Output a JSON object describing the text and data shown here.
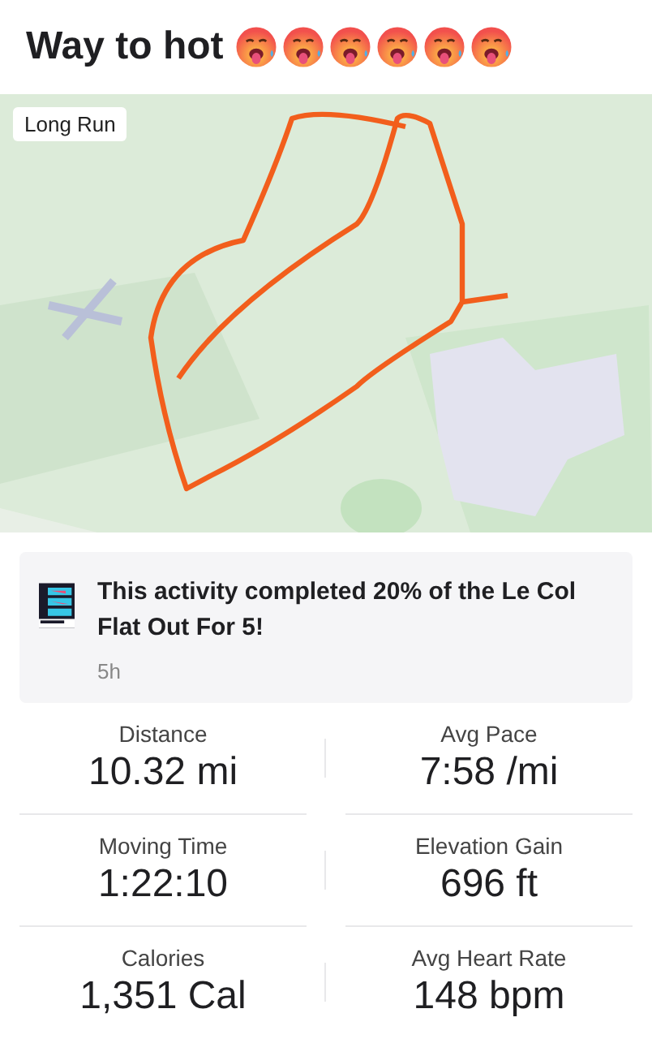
{
  "title": "Way to hot",
  "title_emoji": [
    {
      "kind": "hot-face"
    },
    {
      "kind": "hot-face"
    },
    {
      "kind": "hot-face"
    },
    {
      "kind": "hot-face"
    },
    {
      "kind": "hot-face"
    },
    {
      "kind": "hot-face"
    }
  ],
  "map": {
    "kind": "picture",
    "label": "Long Run"
  },
  "challenge": {
    "text": "This activity completed 20% of the Le Col Flat Out For 5!",
    "time": "5h"
  },
  "stats": [
    {
      "label": "Distance",
      "value": "10.32 mi"
    },
    {
      "label": "Avg Pace",
      "value": "7:58 /mi"
    },
    {
      "label": "Moving Time",
      "value": "1:22:10"
    },
    {
      "label": "Elevation Gain",
      "value": "696 ft"
    },
    {
      "label": "Calories",
      "value": "1,351 Cal"
    },
    {
      "label": "Avg Heart Rate",
      "value": "148 bpm"
    }
  ]
}
